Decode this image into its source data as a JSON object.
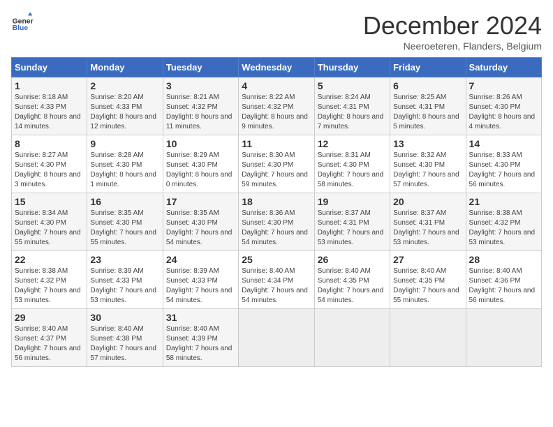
{
  "header": {
    "logo_line1": "General",
    "logo_line2": "Blue",
    "title": "December 2024",
    "subtitle": "Neeroeteren, Flanders, Belgium"
  },
  "calendar": {
    "weekdays": [
      "Sunday",
      "Monday",
      "Tuesday",
      "Wednesday",
      "Thursday",
      "Friday",
      "Saturday"
    ],
    "weeks": [
      [
        {
          "day": "",
          "empty": true
        },
        {
          "day": "",
          "empty": true
        },
        {
          "day": "",
          "empty": true
        },
        {
          "day": "",
          "empty": true
        },
        {
          "day": "5",
          "sunrise": "8:24 AM",
          "sunset": "4:31 PM",
          "daylight": "8 hours and 7 minutes."
        },
        {
          "day": "6",
          "sunrise": "8:25 AM",
          "sunset": "4:31 PM",
          "daylight": "8 hours and 5 minutes."
        },
        {
          "day": "7",
          "sunrise": "8:26 AM",
          "sunset": "4:30 PM",
          "daylight": "8 hours and 4 minutes."
        }
      ],
      [
        {
          "day": "1",
          "sunrise": "8:18 AM",
          "sunset": "4:33 PM",
          "daylight": "8 hours and 14 minutes."
        },
        {
          "day": "2",
          "sunrise": "8:20 AM",
          "sunset": "4:33 PM",
          "daylight": "8 hours and 12 minutes."
        },
        {
          "day": "3",
          "sunrise": "8:21 AM",
          "sunset": "4:32 PM",
          "daylight": "8 hours and 11 minutes."
        },
        {
          "day": "4",
          "sunrise": "8:22 AM",
          "sunset": "4:32 PM",
          "daylight": "8 hours and 9 minutes."
        },
        {
          "day": "5",
          "sunrise": "8:24 AM",
          "sunset": "4:31 PM",
          "daylight": "8 hours and 7 minutes."
        },
        {
          "day": "6",
          "sunrise": "8:25 AM",
          "sunset": "4:31 PM",
          "daylight": "8 hours and 5 minutes."
        },
        {
          "day": "7",
          "sunrise": "8:26 AM",
          "sunset": "4:30 PM",
          "daylight": "8 hours and 4 minutes."
        }
      ],
      [
        {
          "day": "8",
          "sunrise": "8:27 AM",
          "sunset": "4:30 PM",
          "daylight": "8 hours and 3 minutes."
        },
        {
          "day": "9",
          "sunrise": "8:28 AM",
          "sunset": "4:30 PM",
          "daylight": "8 hours and 1 minute."
        },
        {
          "day": "10",
          "sunrise": "8:29 AM",
          "sunset": "4:30 PM",
          "daylight": "8 hours and 0 minutes."
        },
        {
          "day": "11",
          "sunrise": "8:30 AM",
          "sunset": "4:30 PM",
          "daylight": "7 hours and 59 minutes."
        },
        {
          "day": "12",
          "sunrise": "8:31 AM",
          "sunset": "4:30 PM",
          "daylight": "7 hours and 58 minutes."
        },
        {
          "day": "13",
          "sunrise": "8:32 AM",
          "sunset": "4:30 PM",
          "daylight": "7 hours and 57 minutes."
        },
        {
          "day": "14",
          "sunrise": "8:33 AM",
          "sunset": "4:30 PM",
          "daylight": "7 hours and 56 minutes."
        }
      ],
      [
        {
          "day": "15",
          "sunrise": "8:34 AM",
          "sunset": "4:30 PM",
          "daylight": "7 hours and 55 minutes."
        },
        {
          "day": "16",
          "sunrise": "8:35 AM",
          "sunset": "4:30 PM",
          "daylight": "7 hours and 55 minutes."
        },
        {
          "day": "17",
          "sunrise": "8:35 AM",
          "sunset": "4:30 PM",
          "daylight": "7 hours and 54 minutes."
        },
        {
          "day": "18",
          "sunrise": "8:36 AM",
          "sunset": "4:30 PM",
          "daylight": "7 hours and 54 minutes."
        },
        {
          "day": "19",
          "sunrise": "8:37 AM",
          "sunset": "4:31 PM",
          "daylight": "7 hours and 53 minutes."
        },
        {
          "day": "20",
          "sunrise": "8:37 AM",
          "sunset": "4:31 PM",
          "daylight": "7 hours and 53 minutes."
        },
        {
          "day": "21",
          "sunrise": "8:38 AM",
          "sunset": "4:32 PM",
          "daylight": "7 hours and 53 minutes."
        }
      ],
      [
        {
          "day": "22",
          "sunrise": "8:38 AM",
          "sunset": "4:32 PM",
          "daylight": "7 hours and 53 minutes."
        },
        {
          "day": "23",
          "sunrise": "8:39 AM",
          "sunset": "4:33 PM",
          "daylight": "7 hours and 53 minutes."
        },
        {
          "day": "24",
          "sunrise": "8:39 AM",
          "sunset": "4:33 PM",
          "daylight": "7 hours and 54 minutes."
        },
        {
          "day": "25",
          "sunrise": "8:40 AM",
          "sunset": "4:34 PM",
          "daylight": "7 hours and 54 minutes."
        },
        {
          "day": "26",
          "sunrise": "8:40 AM",
          "sunset": "4:35 PM",
          "daylight": "7 hours and 54 minutes."
        },
        {
          "day": "27",
          "sunrise": "8:40 AM",
          "sunset": "4:35 PM",
          "daylight": "7 hours and 55 minutes."
        },
        {
          "day": "28",
          "sunrise": "8:40 AM",
          "sunset": "4:36 PM",
          "daylight": "7 hours and 56 minutes."
        }
      ],
      [
        {
          "day": "29",
          "sunrise": "8:40 AM",
          "sunset": "4:37 PM",
          "daylight": "7 hours and 56 minutes."
        },
        {
          "day": "30",
          "sunrise": "8:40 AM",
          "sunset": "4:38 PM",
          "daylight": "7 hours and 57 minutes."
        },
        {
          "day": "31",
          "sunrise": "8:40 AM",
          "sunset": "4:39 PM",
          "daylight": "7 hours and 58 minutes."
        },
        {
          "day": "",
          "empty": true
        },
        {
          "day": "",
          "empty": true
        },
        {
          "day": "",
          "empty": true
        },
        {
          "day": "",
          "empty": true
        }
      ]
    ]
  }
}
